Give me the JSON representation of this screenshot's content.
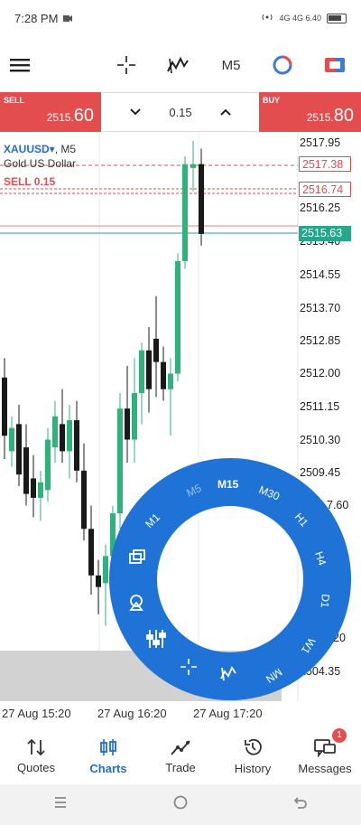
{
  "status_bar": {
    "time": "7:28 PM",
    "signal_text": "4G  4G  6.40"
  },
  "toolbar": {
    "timeframe": "M5"
  },
  "trade": {
    "sell_tag": "SELL",
    "sell_price_main": "2515.",
    "sell_price_big": "60",
    "buy_tag": "BUY",
    "buy_price_main": "2515.",
    "buy_price_big": "80",
    "volume": "0.15"
  },
  "chart": {
    "symbol": "XAUUSD",
    "symbol_timeframe": "M5",
    "description": "Gold US Dollar",
    "order_label": "SELL 0.15",
    "price_levels": [
      "2517.95",
      "2516.25",
      "2515.40",
      "2514.55",
      "2513.70",
      "2512.85",
      "2512.00",
      "2511.15",
      "2510.30",
      "2509.45"
    ],
    "hidden_labels": [
      "7.60",
      "20",
      "2504.35"
    ],
    "tag_high": "2517.38",
    "tag_sell": "2516.74",
    "tag_current": "2515.63",
    "time_labels": [
      "27 Aug 15:20",
      "27 Aug 16:20",
      "27 Aug 17:20"
    ],
    "colors": {
      "bull": "#2db37b",
      "bear": "#1a1a1a",
      "sell": "#e34d4d",
      "wheel": "#1f73d6",
      "current": "#26a68a"
    }
  },
  "wheel": {
    "items": [
      "M5",
      "M15",
      "M30",
      "H1",
      "H4",
      "D1",
      "W1",
      "MN",
      "M1"
    ]
  },
  "nav": {
    "items": [
      {
        "label": "Quotes",
        "icon": "quotes-icon"
      },
      {
        "label": "Charts",
        "icon": "charts-icon"
      },
      {
        "label": "Trade",
        "icon": "trade-icon"
      },
      {
        "label": "History",
        "icon": "history-icon"
      },
      {
        "label": "Messages",
        "icon": "messages-icon"
      }
    ],
    "messages_badge": "1"
  }
}
